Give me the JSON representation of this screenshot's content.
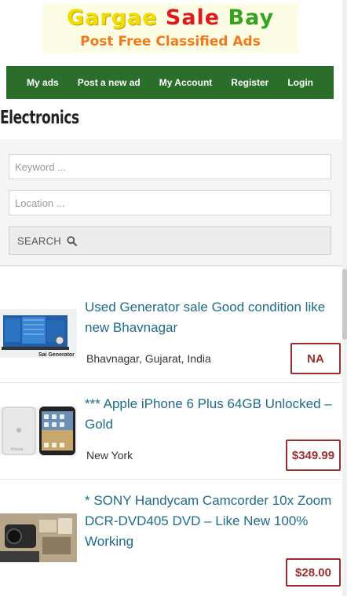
{
  "logo": {
    "word1": "Gargae",
    "word2": "Sale",
    "word3": "Bay",
    "tagline": "Post Free Classified Ads"
  },
  "nav": {
    "items": [
      {
        "label": "My ads"
      },
      {
        "label": "Post a new ad"
      },
      {
        "label": "My Account"
      },
      {
        "label": "Register"
      },
      {
        "label": "Login"
      }
    ]
  },
  "page": {
    "title": "Electronics"
  },
  "search": {
    "keyword_placeholder": "Keyword ...",
    "location_placeholder": "Location ...",
    "button_label": "SEARCH"
  },
  "listings": [
    {
      "title": "Used Generator sale Good condition like new Bhavnagar",
      "location": "Bhavnagar, Gujarat, India",
      "price": "NA",
      "thumb_caption": "Sai Generator"
    },
    {
      "title": "*** Apple iPhone 6 Plus 64GB Unlocked – Gold",
      "location": "New York",
      "price": "$349.99",
      "thumb_caption": "iPhone"
    },
    {
      "title": "* SONY Handycam Camcorder 10x Zoom DCR-DVD405 DVD – Like New 100% Working",
      "location": "",
      "price": "$28.00"
    }
  ],
  "colors": {
    "nav_bg": "#2b6e2b",
    "link": "#1f6b8a",
    "price": "#9b2e2e"
  }
}
